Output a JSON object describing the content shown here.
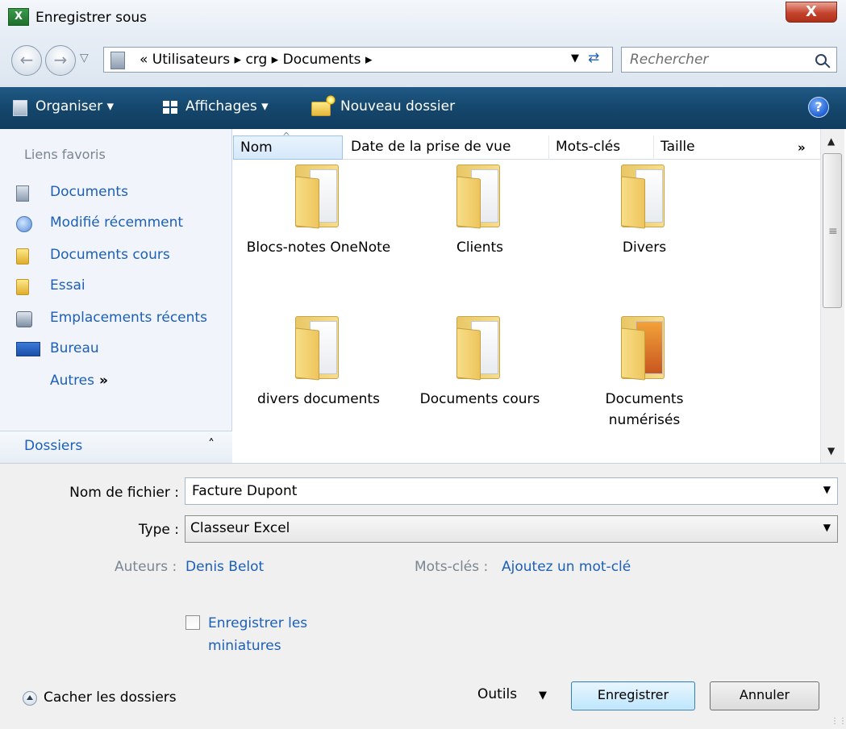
{
  "window": {
    "title": "Enregistrer sous",
    "close_symbol": "X"
  },
  "address": {
    "path_text": "« Utilisateurs ▸ crg ▸ Documents ▸",
    "search_placeholder": "Rechercher"
  },
  "toolbar": {
    "organise_label": "Organiser ▾",
    "views_label": "Affichages ▾",
    "new_folder_label": "Nouveau dossier",
    "help_symbol": "?"
  },
  "sidebar": {
    "heading": "Liens favoris",
    "links": [
      {
        "label": "Documents",
        "icon": "documents-icon"
      },
      {
        "label": "Modifié récemment",
        "icon": "recent-icon"
      },
      {
        "label": "Documents cours",
        "icon": "folder-icon"
      },
      {
        "label": "Essai",
        "icon": "folder-icon"
      },
      {
        "label": "Emplacements récents",
        "icon": "recent-places-icon"
      },
      {
        "label": "Bureau",
        "icon": "desktop-icon"
      }
    ],
    "more_label": "Autres",
    "more_symbol": "»",
    "folders_label": "Dossiers"
  },
  "files": {
    "columns": [
      "Nom",
      "Date de la prise de vue",
      "Mots-clés",
      "Taille"
    ],
    "more_columns_symbol": "»",
    "items": [
      {
        "label": "Blocs-notes OneNote"
      },
      {
        "label": "Clients"
      },
      {
        "label": "Divers"
      },
      {
        "label": "divers documents"
      },
      {
        "label": "Documents cours"
      },
      {
        "label": "Documents numérisés"
      }
    ]
  },
  "form": {
    "filename_label": "Nom de fichier :",
    "filename_value": "Facture Dupont",
    "type_label": "Type :",
    "type_value": "Classeur Excel",
    "authors_label": "Auteurs :",
    "authors_value": "Denis Belot",
    "tags_label": "Mots-clés :",
    "tags_value": "Ajoutez un mot-clé",
    "thumbnails_label": "Enregistrer les miniatures"
  },
  "footer": {
    "hide_folders_label": "Cacher les dossiers",
    "tools_label": "Outils",
    "save_label": "Enregistrer",
    "cancel_label": "Annuler"
  }
}
